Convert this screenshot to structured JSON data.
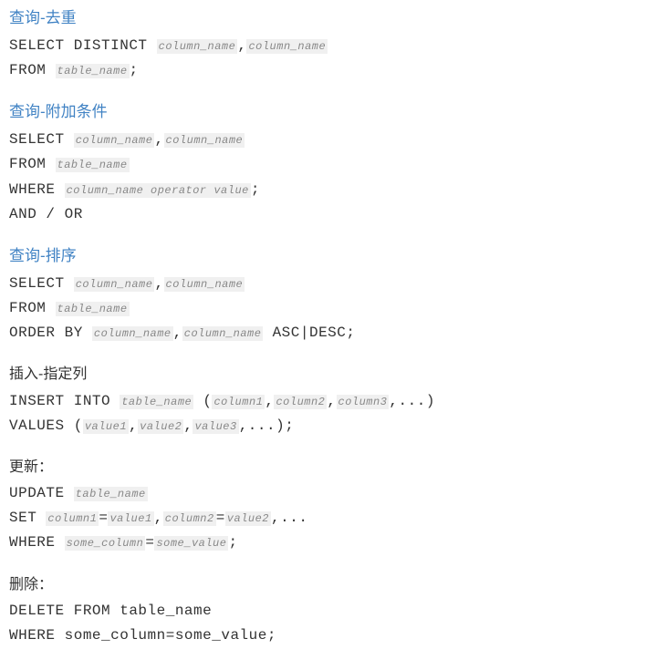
{
  "sections": {
    "distinct": {
      "title": "查询-去重",
      "l1_kw": "SELECT DISTINCT ",
      "l1_ph1": "column_name",
      "l1_sep": ",",
      "l1_ph2": "column_name",
      "l2_kw": "FROM ",
      "l2_ph": "table_name",
      "l2_end": ";"
    },
    "where": {
      "title": "查询-附加条件",
      "l1_kw": "SELECT ",
      "l1_ph1": "column_name",
      "l1_sep": ",",
      "l1_ph2": "column_name",
      "l2_kw": "FROM ",
      "l2_ph": "table_name",
      "l3_kw": "WHERE ",
      "l3_ph": "column_name operator value",
      "l3_end": ";",
      "l4": "AND / OR"
    },
    "orderby": {
      "title": "查询-排序",
      "l1_kw": "SELECT ",
      "l1_ph1": "column_name",
      "l1_sep": ",",
      "l1_ph2": "column_name",
      "l2_kw": "FROM ",
      "l2_ph": "table_name",
      "l3_kw": "ORDER BY ",
      "l3_ph1": "column_name",
      "l3_sep": ",",
      "l3_ph2": "column_name",
      "l3_end": " ASC|DESC;"
    },
    "insert": {
      "title": "插入-指定列",
      "l1_kw": "INSERT INTO ",
      "l1_ph_table": "table_name",
      "l1_open": " (",
      "l1_c1": "column1",
      "l1_s1": ",",
      "l1_c2": "column2",
      "l1_s2": ",",
      "l1_c3": "column3",
      "l1_end": ",...)",
      "l2_kw": "VALUES (",
      "l2_v1": "value1",
      "l2_s1": ",",
      "l2_v2": "value2",
      "l2_s2": ",",
      "l2_v3": "value3",
      "l2_end": ",...);"
    },
    "update": {
      "title": "更新：",
      "l1_kw": "UPDATE ",
      "l1_ph": "table_name",
      "l2_kw": "SET ",
      "l2_c1": "column1",
      "l2_eq1": "=",
      "l2_v1": "value1",
      "l2_s1": ",",
      "l2_c2": "column2",
      "l2_eq2": "=",
      "l2_v2": "value2",
      "l2_end": ",...",
      "l3_kw": "WHERE ",
      "l3_c": "some_column",
      "l3_eq": "=",
      "l3_v": "some_value",
      "l3_end": ";"
    },
    "delete": {
      "title": "删除：",
      "l1": "DELETE FROM table_name",
      "l2": "WHERE some_column=some_value;"
    }
  }
}
